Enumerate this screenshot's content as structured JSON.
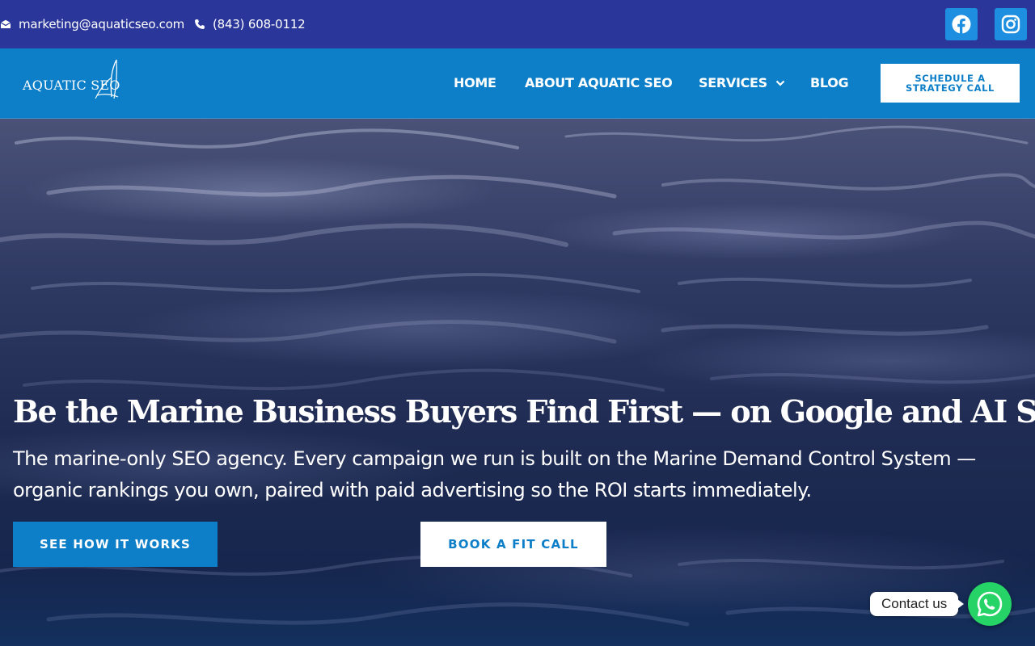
{
  "topbar": {
    "email": "marketing@aquaticseo.com",
    "phone": "(843) 608-0112",
    "social": [
      {
        "icon": "facebook-icon",
        "color": "#1e8fe0"
      },
      {
        "icon": "instagram-icon",
        "color": "#1e8fe0"
      }
    ],
    "background": "#2a3699"
  },
  "nav": {
    "logo_text": "AQUATIC SEO",
    "items": [
      {
        "label": "HOME"
      },
      {
        "label": "ABOUT AQUATIC SEO"
      },
      {
        "label": "SERVICES",
        "has_dropdown": true
      },
      {
        "label": "BLOG"
      }
    ],
    "cta_label": "SCHEDULE A STRATEGY CALL",
    "background": "#0d7fc8"
  },
  "hero": {
    "title": "Be the Marine Business Buyers Find First — on Google and AI Search.",
    "subtitle": "The marine-only SEO agency. Every campaign we run is built on the Marine Demand Control System — organic rankings you own, paired with paid advertising so the ROI starts immediately.",
    "primary_button": "SEE HOW IT WORKS",
    "secondary_button": "BOOK A FIT CALL"
  },
  "chat": {
    "label": "Contact us",
    "icon": "whatsapp-icon",
    "color": "#25d366"
  }
}
